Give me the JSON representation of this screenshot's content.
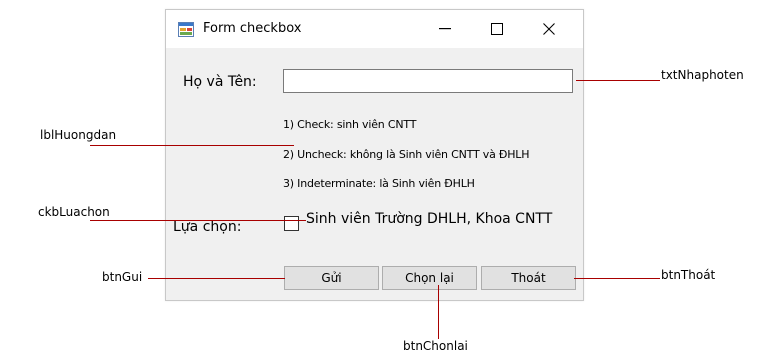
{
  "window": {
    "title": "Form checkbox"
  },
  "form": {
    "name_label": "Họ và Tên:",
    "name_value": "",
    "instructions": [
      "1) Check: sinh viên CNTT",
      "2) Uncheck: không là Sinh viên CNTT và  ĐHLH",
      "3) Indeterminate:  là Sinh viên ĐHLH"
    ],
    "choice_label": "Lựa chọn:",
    "checkbox_label": "Sinh viên Trường DHLH, Khoa CNTT",
    "checkbox_checked": false
  },
  "buttons": {
    "send": "Gửi",
    "reset": "Chọn lại",
    "exit": "Thoát"
  },
  "callouts": {
    "txt": "txtNhaphoten",
    "lbl": "lblHuongdan",
    "ckb": "ckbLuachon",
    "gui": "btnGui",
    "thoat": "btnThoát",
    "chonlai": "btnChonlai"
  },
  "colors": {
    "callout_line": "#a80000",
    "window_bg": "#f0f0f0",
    "button_bg": "#e1e1e1"
  }
}
